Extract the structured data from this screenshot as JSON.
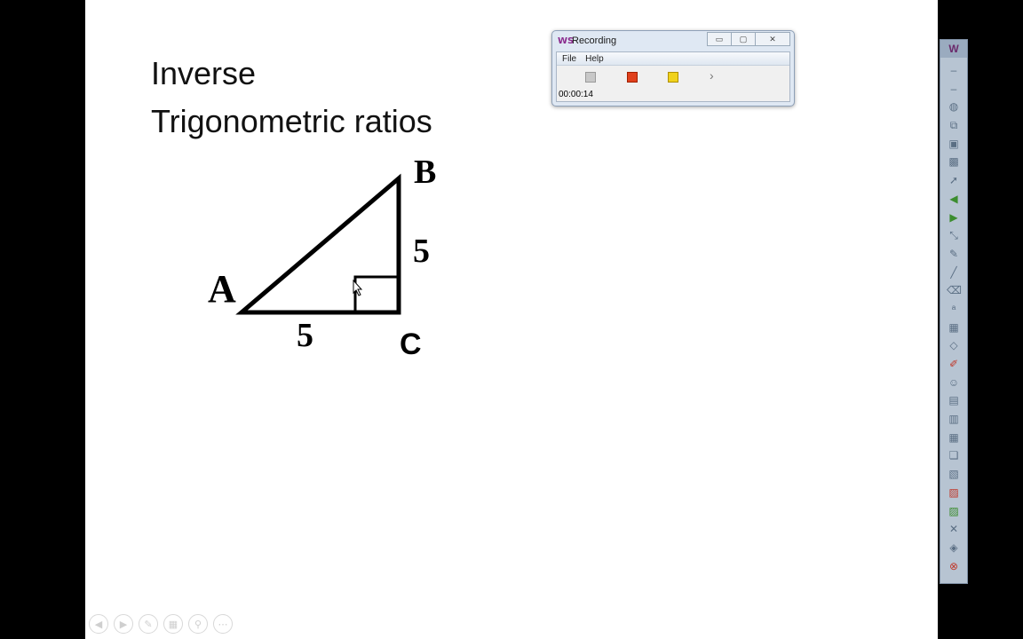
{
  "slide": {
    "title_line1": "Inverse",
    "title_line2": "Trigonometric ratios",
    "diagram": {
      "vertex_a": "A",
      "vertex_b": "B",
      "vertex_c": "C",
      "side_ac": "5",
      "side_bc": "5"
    },
    "nav_controls": [
      "previous",
      "next",
      "pen",
      "slides",
      "zoom",
      "more"
    ]
  },
  "recording_window": {
    "app_logo": "WS",
    "title": "Recording",
    "menu": [
      "File",
      "Help"
    ],
    "tools": [
      "record",
      "stop",
      "pause",
      "next"
    ],
    "elapsed": "00:00:14",
    "window_buttons": [
      "minimize",
      "maximize",
      "close"
    ]
  },
  "toolbar": {
    "logo": "W",
    "icons": [
      "dash-icon",
      "dash-icon",
      "mouse-icon",
      "copy-icon",
      "screenshot-icon",
      "image-icon",
      "pointer-icon",
      "arrow-left-icon",
      "arrow-right-icon",
      "scale-icon",
      "pen-icon",
      "line-icon",
      "erase-icon",
      "text-add-icon",
      "grid-add-icon",
      "shape-icon",
      "pen-red-icon",
      "person-icon",
      "doc-icon",
      "chart-icon",
      "table-icon",
      "layers-icon",
      "clipboard-icon",
      "clip-red-icon",
      "clip-green-icon",
      "close-x-icon",
      "eraser-icon",
      "stop-red-icon"
    ]
  }
}
